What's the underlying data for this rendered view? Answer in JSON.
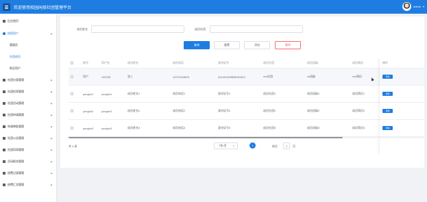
{
  "header": {
    "title": "欢迎使用校园闲择社团管理平台",
    "user_name": "admin",
    "colors": {
      "primary": "#1f7de2",
      "danger": "#f56c6c"
    }
  },
  "sidebar": {
    "items": [
      {
        "label": "后台首页",
        "icon": "home-icon"
      },
      {
        "label": "校园用户",
        "icon": "user-icon",
        "expanded": true
      },
      {
        "label": "管理员",
        "sub": true
      },
      {
        "label": "社团成员",
        "sub": true,
        "active": true
      },
      {
        "label": "购买用户",
        "sub": true
      },
      {
        "label": "社团分类管理",
        "icon": "grid-icon"
      },
      {
        "label": "社团信息管理",
        "icon": "grid-icon"
      },
      {
        "label": "社团活动管理",
        "icon": "grid-icon"
      },
      {
        "label": "社团申请管理",
        "icon": "grid-icon"
      },
      {
        "label": "申请审批管理",
        "icon": "grid-icon"
      },
      {
        "label": "社团公告管理",
        "icon": "grid-icon"
      },
      {
        "label": "社团风采管理",
        "icon": "grid-icon"
      },
      {
        "label": "活动报名管理",
        "icon": "grid-icon"
      },
      {
        "label": "经费记录管理",
        "icon": "grid-icon"
      },
      {
        "label": "经费汇总管理",
        "icon": "grid-icon"
      }
    ]
  },
  "filters": {
    "name_label": "成员姓名",
    "name_value": "",
    "club_label": "成员社团",
    "club_value": ""
  },
  "actions": {
    "search": "查询",
    "reset": "重置",
    "add": "添加",
    "delete": "删除"
  },
  "table": {
    "columns": [
      "账号",
      "用户名",
      "成员姓名",
      "成员电话",
      "身份证号",
      "成员社团",
      "成员班级",
      "成员简历"
    ],
    "op_column": "操作",
    "detail_label": "详情",
    "rows": [
      [
        "用户",
        "112233",
        "张三",
        "13712345678",
        "441401199805061512",
        "xxx社团",
        "xx班级",
        "xxx简历"
      ],
      [
        "yonghu1",
        "yonghu1",
        "成员姓名1",
        "成员电话1",
        "身份证号1",
        "成员社团1",
        "成员班级1",
        "成员简历1"
      ],
      [
        "yonghu2",
        "yonghu2",
        "成员姓名2",
        "成员电话2",
        "身份证号2",
        "成员社团2",
        "成员班级2",
        "成员简历2"
      ],
      [
        "yonghu3",
        "yonghu3",
        "成员姓名3",
        "成员电话3",
        "身份证号3",
        "成员社团3",
        "成员班级3",
        "成员简历3"
      ]
    ]
  },
  "pagination": {
    "total": "共 4 条",
    "page_size": "7条/页",
    "current": "1",
    "goto_prefix": "前往",
    "goto_value": "1",
    "goto_suffix": "页"
  }
}
